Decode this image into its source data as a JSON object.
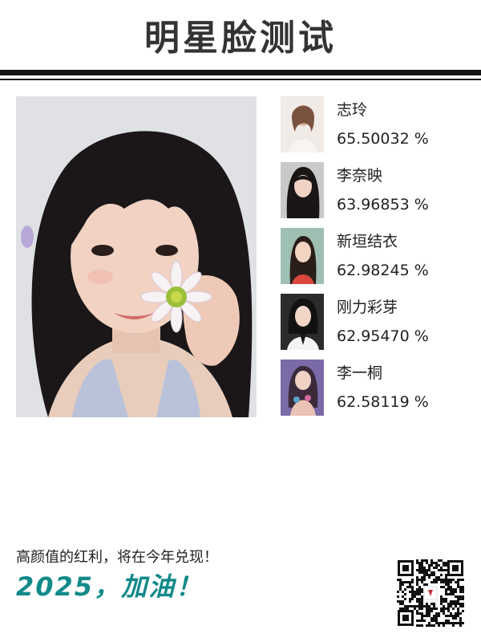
{
  "header": {
    "title": "明星脸测试"
  },
  "matches": [
    {
      "name": "志玲",
      "score": "65.50032 %"
    },
    {
      "name": "李奈映",
      "score": "63.96853 %"
    },
    {
      "name": "新垣结衣",
      "score": "62.98245 %"
    },
    {
      "name": "刚力彩芽",
      "score": "62.95470 %"
    },
    {
      "name": "李一桐",
      "score": "62.58119 %"
    }
  ],
  "footer": {
    "slogan": "高颜值的红利，将在今年兑现！",
    "motto": "2025，加油！"
  },
  "colors": {
    "accent": "#138a8a",
    "title": "#333333",
    "rule": "#111111"
  }
}
